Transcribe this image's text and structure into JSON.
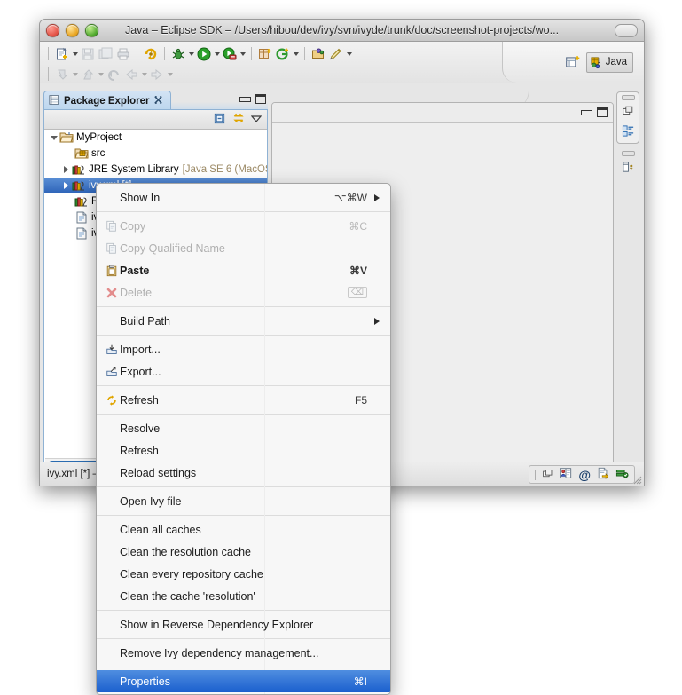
{
  "window": {
    "title": "Java – Eclipse SDK – /Users/hibou/dev/ivy/svn/ivyde/trunk/doc/screenshot-projects/wo...",
    "controls": {
      "close": "close-button",
      "minimize": "minimize-button",
      "zoom": "zoom-button"
    }
  },
  "toolbar": {
    "row1": [
      {
        "name": "new-wizard",
        "icon": "new-file-icon",
        "arrow": true,
        "enabled": true
      },
      {
        "name": "save",
        "icon": "save-icon",
        "arrow": false,
        "enabled": false
      },
      {
        "name": "save-all",
        "icon": "save-all-icon",
        "arrow": false,
        "enabled": false
      },
      {
        "name": "print",
        "icon": "print-icon",
        "arrow": false,
        "enabled": false
      },
      {
        "name": "build-all",
        "icon": "build-icon",
        "arrow": false,
        "enabled": true
      },
      {
        "name": "debug",
        "icon": "debug-icon",
        "arrow": true,
        "enabled": true
      },
      {
        "name": "run",
        "icon": "run-icon",
        "arrow": true,
        "enabled": true
      },
      {
        "name": "external-tools",
        "icon": "external-tools-icon",
        "arrow": true,
        "enabled": true
      },
      {
        "name": "new-java-project",
        "icon": "new-java-project-icon",
        "arrow": false,
        "enabled": true
      },
      {
        "name": "new-class",
        "icon": "new-class-icon",
        "arrow": true,
        "enabled": true
      },
      {
        "name": "open-type",
        "icon": "open-type-icon",
        "arrow": false,
        "enabled": true
      },
      {
        "name": "search",
        "icon": "search-pencil-icon",
        "arrow": true,
        "enabled": true
      }
    ],
    "row2": [
      {
        "name": "next-annotation",
        "icon": "next-annotation-icon",
        "arrow": true,
        "enabled": false
      },
      {
        "name": "previous-annotation",
        "icon": "previous-annotation-icon",
        "arrow": true,
        "enabled": false
      },
      {
        "name": "last-edit-location",
        "icon": "last-edit-icon",
        "arrow": false,
        "enabled": false
      },
      {
        "name": "back",
        "icon": "back-arrow-icon",
        "arrow": true,
        "enabled": false
      },
      {
        "name": "forward",
        "icon": "forward-arrow-icon",
        "arrow": true,
        "enabled": false
      }
    ]
  },
  "perspective": {
    "open_label": "open-perspective-icon",
    "active": "Java"
  },
  "package_explorer": {
    "tab_label": "Package Explorer",
    "tab_icon": "package-explorer-icon",
    "close_icon": "close-icon",
    "toolbar": [
      {
        "name": "collapse-all",
        "icon": "collapse-all-icon"
      },
      {
        "name": "link-with-editor",
        "icon": "link-with-editor-icon"
      },
      {
        "name": "view-menu",
        "icon": "chevron-down-icon"
      }
    ],
    "minimize": "minimize-view-button",
    "maximize": "maximize-view-button",
    "tree": [
      {
        "label": "MyProject",
        "suffix": "",
        "icon": "project-icon",
        "twisty": "open",
        "indent": 0,
        "selected": false
      },
      {
        "label": "src",
        "suffix": "",
        "icon": "source-folder-icon",
        "twisty": "none",
        "indent": 1,
        "selected": false
      },
      {
        "label": "JRE System Library",
        "suffix": "[Java SE 6 (MacOS",
        "icon": "library-icon",
        "twisty": "closed",
        "indent": 1,
        "selected": false
      },
      {
        "label": "ivy.xml [*]",
        "suffix": "",
        "icon": "ivy-library-icon",
        "twisty": "closed",
        "indent": 1,
        "selected": true
      },
      {
        "label": "Referenced Libraries",
        "suffix": "",
        "icon": "library-icon",
        "twisty": "none",
        "indent": 1,
        "selected": false
      },
      {
        "label": "ivy.xml",
        "suffix": "",
        "icon": "xml-file-icon",
        "twisty": "none",
        "indent": 1,
        "selected": false
      },
      {
        "label": "ivysettings.xml",
        "suffix": "",
        "icon": "xml-file-icon",
        "twisty": "none",
        "indent": 1,
        "selected": false
      }
    ]
  },
  "editor": {
    "minimize": "minimize-editor-button",
    "maximize": "maximize-editor-button"
  },
  "fast_view": [
    {
      "name": "fast-view-group-1",
      "icons": [
        "copy-stack-icon",
        "outline-icon"
      ]
    },
    {
      "name": "fast-view-group-2",
      "icons": [
        "properties-view-icon"
      ]
    }
  ],
  "status": {
    "text": "ivy.xml [*] – MyProject",
    "trim_icons": [
      "editor-stack-icon",
      "user-badge-icon",
      "at-sign-icon",
      "document-arrow-icon",
      "server-icon"
    ]
  },
  "context_menu": {
    "items": [
      {
        "type": "item",
        "label": "Show In",
        "key": "⌥⌘W",
        "submenu": true,
        "icon": "",
        "state": "normal"
      },
      {
        "type": "sep"
      },
      {
        "type": "item",
        "label": "Copy",
        "key": "⌘C",
        "submenu": false,
        "icon": "copy-icon",
        "state": "disabled"
      },
      {
        "type": "item",
        "label": "Copy Qualified Name",
        "key": "",
        "submenu": false,
        "icon": "copy-icon",
        "state": "disabled"
      },
      {
        "type": "item",
        "label": "Paste",
        "key": "⌘V",
        "submenu": false,
        "icon": "paste-icon",
        "state": "bold"
      },
      {
        "type": "item",
        "label": "Delete",
        "key": "⌫",
        "submenu": false,
        "icon": "delete-x-icon",
        "state": "disabled"
      },
      {
        "type": "sep"
      },
      {
        "type": "item",
        "label": "Build Path",
        "key": "",
        "submenu": true,
        "icon": "",
        "state": "normal"
      },
      {
        "type": "sep"
      },
      {
        "type": "item",
        "label": "Import...",
        "key": "",
        "submenu": false,
        "icon": "import-icon",
        "state": "normal"
      },
      {
        "type": "item",
        "label": "Export...",
        "key": "",
        "submenu": false,
        "icon": "export-icon",
        "state": "normal"
      },
      {
        "type": "sep"
      },
      {
        "type": "item",
        "label": "Refresh",
        "key": "F5",
        "submenu": false,
        "icon": "refresh-icon",
        "state": "normal"
      },
      {
        "type": "sep"
      },
      {
        "type": "item",
        "label": "Resolve",
        "key": "",
        "submenu": false,
        "icon": "",
        "state": "normal"
      },
      {
        "type": "item",
        "label": "Refresh",
        "key": "",
        "submenu": false,
        "icon": "",
        "state": "normal"
      },
      {
        "type": "item",
        "label": "Reload settings",
        "key": "",
        "submenu": false,
        "icon": "",
        "state": "normal"
      },
      {
        "type": "sep"
      },
      {
        "type": "item",
        "label": "Open Ivy file",
        "key": "",
        "submenu": false,
        "icon": "",
        "state": "normal"
      },
      {
        "type": "sep"
      },
      {
        "type": "item",
        "label": "Clean all caches",
        "key": "",
        "submenu": false,
        "icon": "",
        "state": "normal"
      },
      {
        "type": "item",
        "label": "Clean the resolution cache",
        "key": "",
        "submenu": false,
        "icon": "",
        "state": "normal"
      },
      {
        "type": "item",
        "label": "Clean every repository cache",
        "key": "",
        "submenu": false,
        "icon": "",
        "state": "normal"
      },
      {
        "type": "item",
        "label": "Clean the cache 'resolution'",
        "key": "",
        "submenu": false,
        "icon": "",
        "state": "normal"
      },
      {
        "type": "sep"
      },
      {
        "type": "item",
        "label": "Show in Reverse Dependency Explorer",
        "key": "",
        "submenu": false,
        "icon": "",
        "state": "normal"
      },
      {
        "type": "sep"
      },
      {
        "type": "item",
        "label": "Remove Ivy dependency management...",
        "key": "",
        "submenu": false,
        "icon": "",
        "state": "normal"
      },
      {
        "type": "sep"
      },
      {
        "type": "item",
        "label": "Properties",
        "key": "⌘I",
        "submenu": false,
        "icon": "",
        "state": "selected"
      }
    ]
  },
  "colors": {
    "selection_blue": "#1b5fce",
    "tab_blue": "#bcd6ee",
    "window_chrome": "#e8e8e8",
    "menu_bg": "#f7f7f7"
  }
}
